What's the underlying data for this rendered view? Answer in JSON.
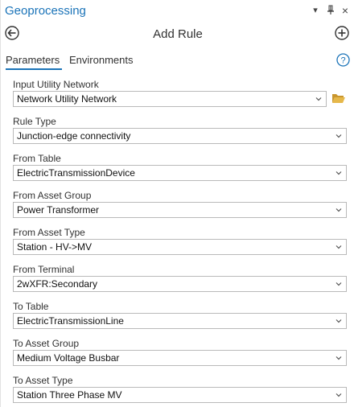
{
  "titlebar": {
    "title": "Geoprocessing",
    "dropdown_glyph": "▾",
    "pin_glyph": "⊥",
    "close_glyph": "×"
  },
  "tool": {
    "title": "Add Rule",
    "back_icon": "back-arrow-circle-icon",
    "add_icon": "plus-circle-icon"
  },
  "tabs": {
    "parameters": "Parameters",
    "environments": "Environments",
    "active": "parameters"
  },
  "help_icon": "question-circle-icon",
  "accent_color": "#1a73b8",
  "folder_color": "#e6b84a",
  "fields": [
    {
      "label": "Input Utility Network",
      "value": "Network Utility Network"
    },
    {
      "label": "Rule Type",
      "value": "Junction-edge connectivity"
    },
    {
      "label": "From Table",
      "value": "ElectricTransmissionDevice"
    },
    {
      "label": "From Asset Group",
      "value": "Power Transformer"
    },
    {
      "label": "From Asset Type",
      "value": "Station - HV->MV"
    },
    {
      "label": "From Terminal",
      "value": "2wXFR:Secondary"
    },
    {
      "label": "To Table",
      "value": "ElectricTransmissionLine"
    },
    {
      "label": "To Asset Group",
      "value": "Medium Voltage Busbar"
    },
    {
      "label": "To Asset Type",
      "value": "Station Three Phase MV"
    }
  ]
}
